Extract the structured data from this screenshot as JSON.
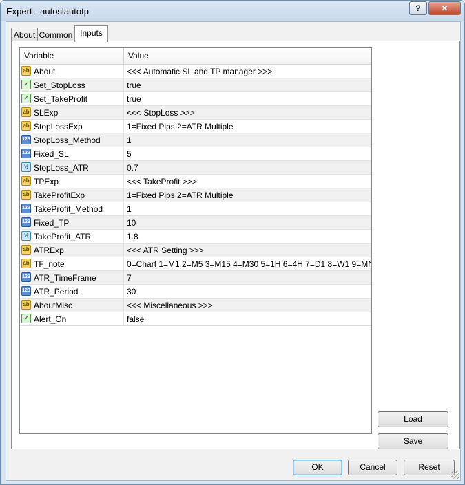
{
  "window": {
    "title": "Expert - autoslautotp",
    "help_label": "?",
    "close_label": "✕"
  },
  "tabs": [
    {
      "label": "About"
    },
    {
      "label": "Common"
    },
    {
      "label": "Inputs"
    }
  ],
  "grid": {
    "columns": [
      "Variable",
      "Value"
    ],
    "rows": [
      {
        "icon": "string-ab-icon",
        "name": "About",
        "value": "<<< Automatic SL and TP manager >>>"
      },
      {
        "icon": "bool-icon",
        "name": "Set_StopLoss",
        "value": "true"
      },
      {
        "icon": "bool-icon",
        "name": "Set_TakeProfit",
        "value": "true"
      },
      {
        "icon": "string-ab-icon",
        "name": "SLExp",
        "value": "<<< StopLoss >>>"
      },
      {
        "icon": "string-ab-icon",
        "name": "StopLossExp",
        "value": "1=Fixed Pips  2=ATR Multiple"
      },
      {
        "icon": "integer-icon",
        "name": "StopLoss_Method",
        "value": "1"
      },
      {
        "icon": "integer-icon",
        "name": "Fixed_SL",
        "value": "5"
      },
      {
        "icon": "double-icon",
        "name": "StopLoss_ATR",
        "value": "0.7"
      },
      {
        "icon": "string-ab-icon",
        "name": "TPExp",
        "value": "<<< TakeProfit >>>"
      },
      {
        "icon": "string-ab-icon",
        "name": "TakeProfitExp",
        "value": "1=Fixed Pips  2=ATR Multiple"
      },
      {
        "icon": "integer-icon",
        "name": "TakeProfit_Method",
        "value": "1"
      },
      {
        "icon": "integer-icon",
        "name": "Fixed_TP",
        "value": "10"
      },
      {
        "icon": "double-icon",
        "name": "TakeProfit_ATR",
        "value": "1.8"
      },
      {
        "icon": "string-ab-icon",
        "name": "ATRExp",
        "value": "<<< ATR Setting >>>"
      },
      {
        "icon": "string-ab-icon",
        "name": "TF_note",
        "value": "0=Chart 1=M1 2=M5 3=M15 4=M30 5=1H 6=4H 7=D1 8=W1 9=MN"
      },
      {
        "icon": "integer-icon",
        "name": "ATR_TimeFrame",
        "value": "7"
      },
      {
        "icon": "integer-icon",
        "name": "ATR_Period",
        "value": "30"
      },
      {
        "icon": "string-ab-icon",
        "name": "AboutMisc",
        "value": "<<< Miscellaneous >>>"
      },
      {
        "icon": "bool-icon",
        "name": "Alert_On",
        "value": "false"
      }
    ]
  },
  "side_buttons": {
    "load": "Load",
    "save": "Save"
  },
  "footer_buttons": {
    "ok": "OK",
    "cancel": "Cancel",
    "reset": "Reset"
  }
}
